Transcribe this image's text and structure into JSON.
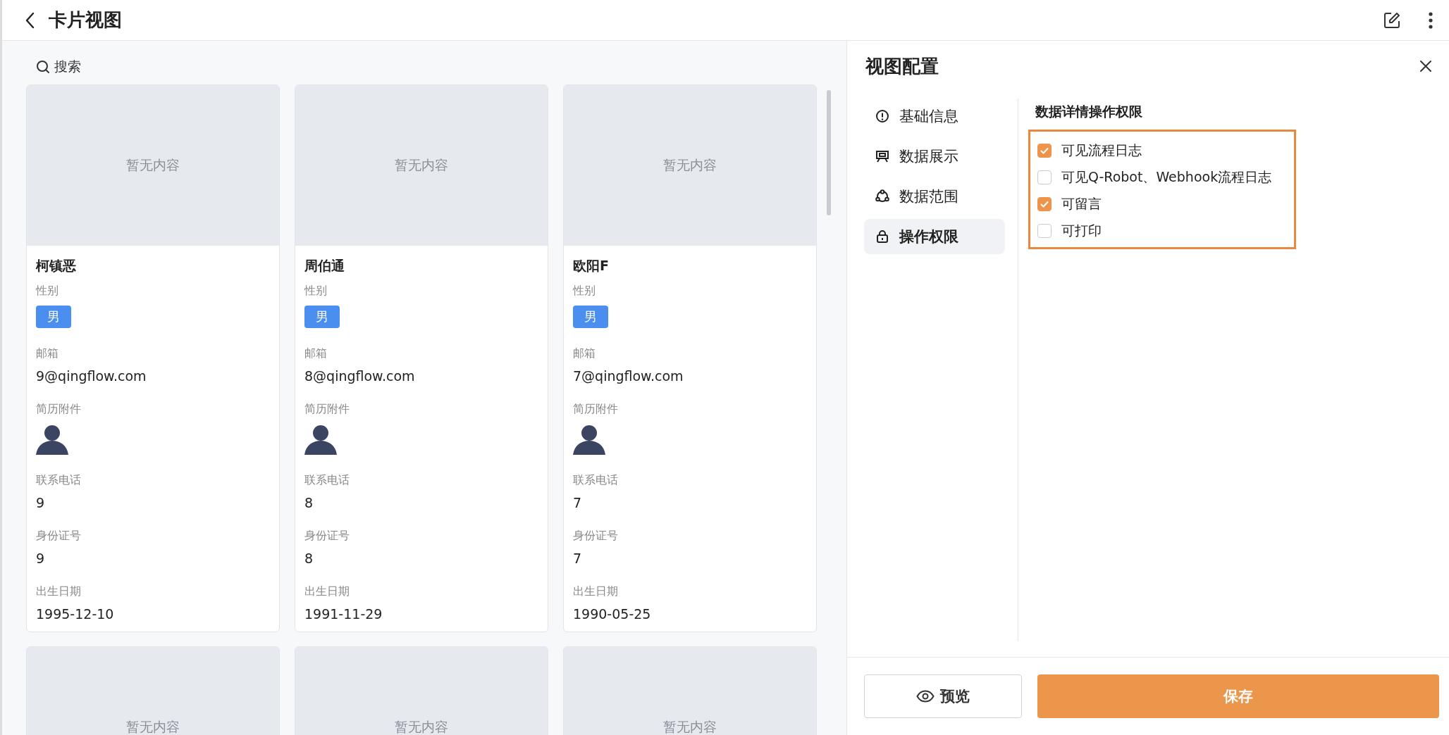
{
  "header": {
    "title": "卡片视图"
  },
  "search": {
    "label": "搜索"
  },
  "cards": [
    {
      "cover": "暂无内容",
      "title": "柯镇恶",
      "fields": [
        {
          "label": "性别",
          "kind": "tag",
          "value": "男"
        },
        {
          "label": "邮箱",
          "kind": "text",
          "value": "9@qingflow.com"
        },
        {
          "label": "简历附件",
          "kind": "avatar"
        },
        {
          "label": "联系电话",
          "kind": "text",
          "value": "9"
        },
        {
          "label": "身份证号",
          "kind": "text",
          "value": "9"
        },
        {
          "label": "出生日期",
          "kind": "text",
          "value": "1995-12-10"
        }
      ]
    },
    {
      "cover": "暂无内容",
      "title": "周伯通",
      "fields": [
        {
          "label": "性别",
          "kind": "tag",
          "value": "男"
        },
        {
          "label": "邮箱",
          "kind": "text",
          "value": "8@qingflow.com"
        },
        {
          "label": "简历附件",
          "kind": "avatar"
        },
        {
          "label": "联系电话",
          "kind": "text",
          "value": "8"
        },
        {
          "label": "身份证号",
          "kind": "text",
          "value": "8"
        },
        {
          "label": "出生日期",
          "kind": "text",
          "value": "1991-11-29"
        }
      ]
    },
    {
      "cover": "暂无内容",
      "title": "欧阳F",
      "fields": [
        {
          "label": "性别",
          "kind": "tag",
          "value": "男"
        },
        {
          "label": "邮箱",
          "kind": "text",
          "value": "7@qingflow.com"
        },
        {
          "label": "简历附件",
          "kind": "avatar"
        },
        {
          "label": "联系电话",
          "kind": "text",
          "value": "7"
        },
        {
          "label": "身份证号",
          "kind": "text",
          "value": "7"
        },
        {
          "label": "出生日期",
          "kind": "text",
          "value": "1990-05-25"
        }
      ]
    },
    {
      "cover": "暂无内容"
    },
    {
      "cover": "暂无内容"
    },
    {
      "cover": "暂无内容"
    }
  ],
  "panel": {
    "title": "视图配置",
    "menu": [
      {
        "label": "基础信息",
        "kind": "info",
        "selected": false
      },
      {
        "label": "数据展示",
        "kind": "display",
        "selected": false
      },
      {
        "label": "数据范围",
        "kind": "scope",
        "selected": false
      },
      {
        "label": "操作权限",
        "kind": "lock",
        "selected": true
      }
    ],
    "section_title": "数据详情操作权限",
    "options": [
      {
        "label": "可见流程日志",
        "checked": true
      },
      {
        "label": "可见Q-Robot、Webhook流程日志",
        "checked": false
      },
      {
        "label": "可留言",
        "checked": true
      },
      {
        "label": "可打印",
        "checked": false
      }
    ],
    "preview_button": "预览",
    "save_button": "保存"
  }
}
